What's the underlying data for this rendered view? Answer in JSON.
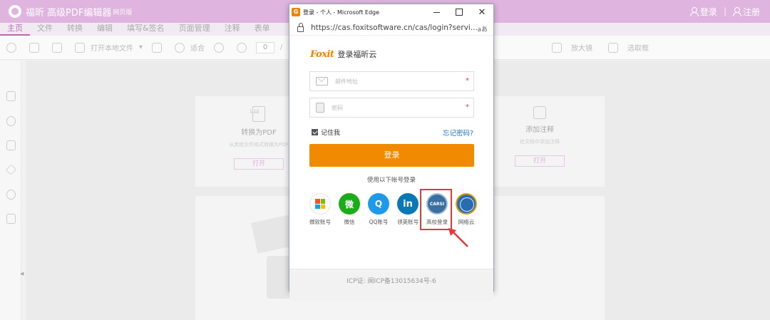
{
  "app": {
    "name": "福昕",
    "product": "高级PDF编辑器",
    "edition": "网页版",
    "login_label": "登录",
    "register_label": "注册",
    "separator": "|"
  },
  "menu": {
    "items": [
      "主页",
      "文件",
      "转换",
      "编辑",
      "填写&签名",
      "页面管理",
      "注释",
      "表单"
    ],
    "active_index": 0
  },
  "toolbar": {
    "open_local": "打开本地文件",
    "fit_label": "适合",
    "page_value": "0",
    "page_sep": "/",
    "right_labels": [
      "放大镜",
      "选取框"
    ]
  },
  "workspace": {
    "feature_left": {
      "title": "转换为PDF",
      "desc": "从其他文件格式转换为PDF",
      "button": "打开"
    },
    "feature_right": {
      "title": "添加注释",
      "desc": "在文档中添加注释",
      "button": "打开"
    }
  },
  "popup": {
    "window_title": "登录 - 个人 - Microsoft Edge",
    "url": "https://cas.foxitsoftware.cn/cas/login?servi...",
    "read_aloud_glyph": "aあ",
    "brand_logo": "Foxit",
    "brand_title": "登录福昕云",
    "email_placeholder": "邮件地址",
    "password_placeholder": "密码",
    "required_mark": "*",
    "remember_label": "记住我",
    "forgot_label": "忘记密码?",
    "login_button": "登录",
    "alt_login_text": "使用以下帐号登录",
    "socials": [
      {
        "label": "微软账号",
        "glyph": ""
      },
      {
        "label": "微信",
        "glyph": "微"
      },
      {
        "label": "QQ账号",
        "glyph": "Q"
      },
      {
        "label": "领英账号",
        "glyph": "in"
      },
      {
        "label": "高校登录",
        "glyph": "CARSI"
      },
      {
        "label": "网络云",
        "glyph": ""
      }
    ],
    "highlighted_social": "高校登录",
    "icp": "ICP证: 闽ICP备13015634号-6"
  },
  "colors": {
    "titlebar": "#dfb5df",
    "accent_purple": "#b36db3",
    "orange": "#f28a00",
    "link_blue": "#1a73c7",
    "highlight_red": "#e53935"
  }
}
